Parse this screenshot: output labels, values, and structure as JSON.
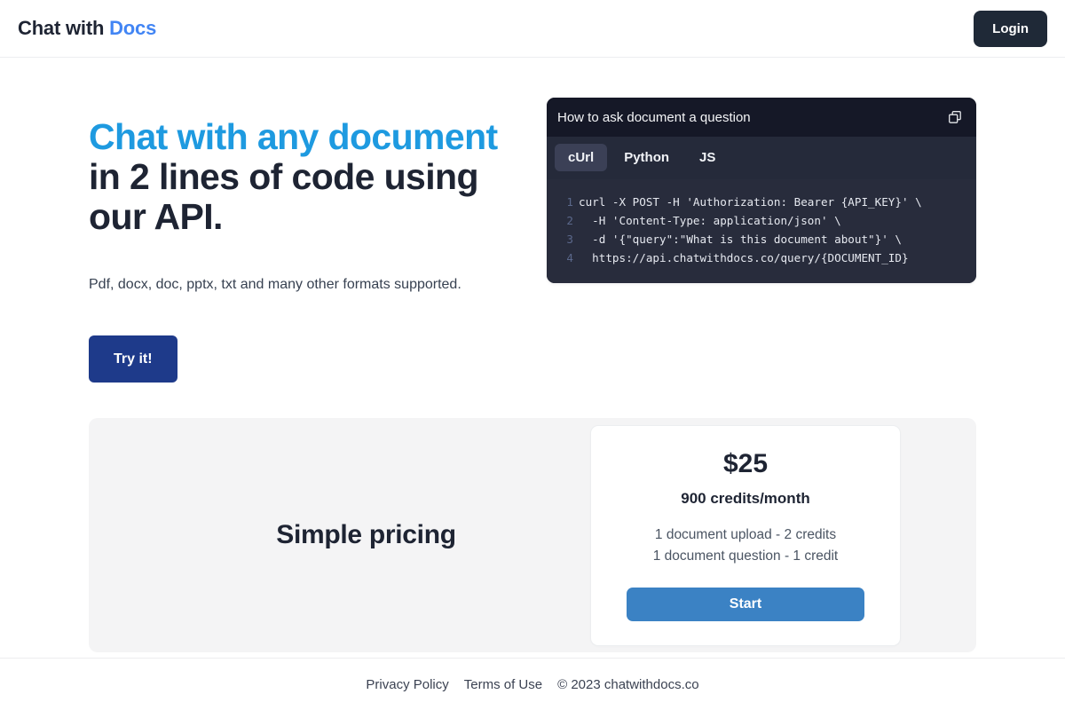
{
  "header": {
    "brand_prefix": "Chat with ",
    "brand_accent": "Docs",
    "login_label": "Login"
  },
  "hero": {
    "headline_blue": "Chat with any document",
    "headline_rest": "in 2 lines of code using our API.",
    "subtext": "Pdf, docx, doc, pptx, txt and many other formats supported.",
    "cta_label": "Try it!"
  },
  "code_panel": {
    "title": "How to ask document a question",
    "copy_icon": "copy-icon",
    "tabs": [
      {
        "label": "cUrl",
        "active": true
      },
      {
        "label": "Python",
        "active": false
      },
      {
        "label": "JS",
        "active": false
      }
    ],
    "lines": [
      {
        "n": "1",
        "text": "curl -X POST -H 'Authorization: Bearer {API_KEY}' \\"
      },
      {
        "n": "2",
        "text": "  -H 'Content-Type: application/json' \\"
      },
      {
        "n": "3",
        "text": "  -d '{\"query\":\"What is this document about\"}' \\"
      },
      {
        "n": "4",
        "text": "  https://api.chatwithdocs.co/query/{DOCUMENT_ID}"
      }
    ]
  },
  "pricing": {
    "section_title": "Simple pricing",
    "card": {
      "amount": "$25",
      "credits": "900 credits/month",
      "features": [
        "1 document upload - 2 credits",
        "1 document question - 1 credit"
      ],
      "cta_label": "Start"
    }
  },
  "footer": {
    "privacy_label": "Privacy Policy",
    "terms_label": "Terms of Use",
    "copyright": "© 2023 chatwithdocs.co"
  },
  "colors": {
    "brand_accent": "#4285f4",
    "headline_blue": "#1e9ae0",
    "try_button": "#1e3a8a",
    "start_button": "#3b82c4",
    "login_button": "#1f2937",
    "code_panel_bg": "#282c3c",
    "code_header_bg": "#151827",
    "pricing_bg": "#f4f4f5"
  }
}
